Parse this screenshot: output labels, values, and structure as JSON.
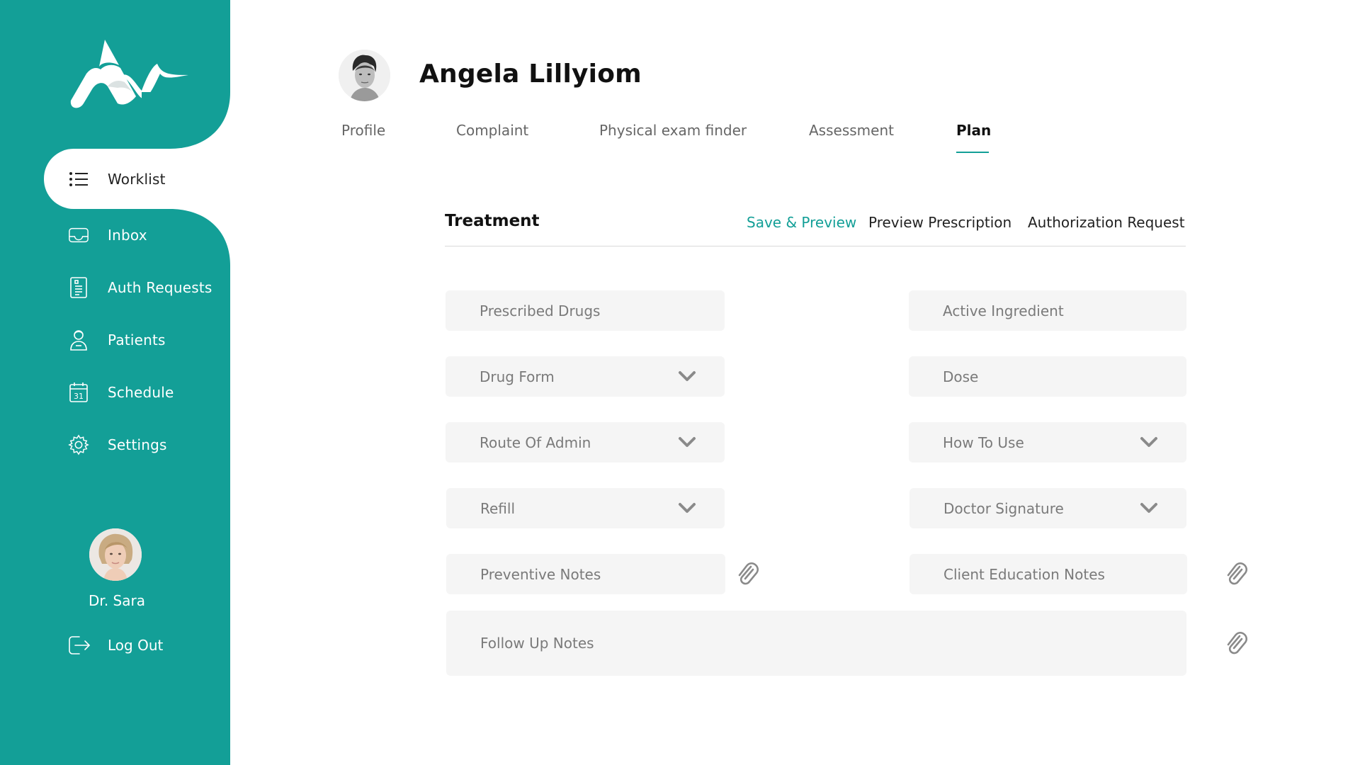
{
  "app": {
    "brand_color": "#139f97",
    "logo_icon": "brand-logo"
  },
  "sidebar": {
    "items": [
      {
        "label": "Worklist",
        "icon": "list-icon",
        "active": true
      },
      {
        "label": "Inbox",
        "icon": "inbox-icon"
      },
      {
        "label": "Auth Requests",
        "icon": "document-icon"
      },
      {
        "label": "Patients",
        "icon": "patient-icon"
      },
      {
        "label": "Schedule",
        "icon": "calendar-icon"
      },
      {
        "label": "Settings",
        "icon": "gear-icon"
      }
    ],
    "user_name": "Dr. Sara",
    "logout_label": "Log Out"
  },
  "patient": {
    "name": "Angela Lillyiom"
  },
  "tabs": [
    {
      "label": "Profile"
    },
    {
      "label": "Complaint"
    },
    {
      "label": "Physical exam finder"
    },
    {
      "label": "Assessment"
    },
    {
      "label": "Plan",
      "active": true
    }
  ],
  "treatment": {
    "title": "Treatment",
    "actions": {
      "save_preview": "Save & Preview",
      "preview_prescription": "Preview Prescription",
      "authorization_request": "Authorization Request"
    },
    "fields": {
      "prescribed_drugs": "Prescribed Drugs",
      "active_ingredient": "Active Ingredient",
      "drug_form": "Drug Form",
      "dose": "Dose",
      "route_of_admin": "Route Of Admin",
      "how_to_use": "How To Use",
      "refill": "Refill",
      "doctor_signature": "Doctor Signature",
      "preventive_notes": "Preventive Notes",
      "client_education_notes": "Client Education Notes",
      "follow_up_notes": "Follow Up Notes"
    }
  }
}
